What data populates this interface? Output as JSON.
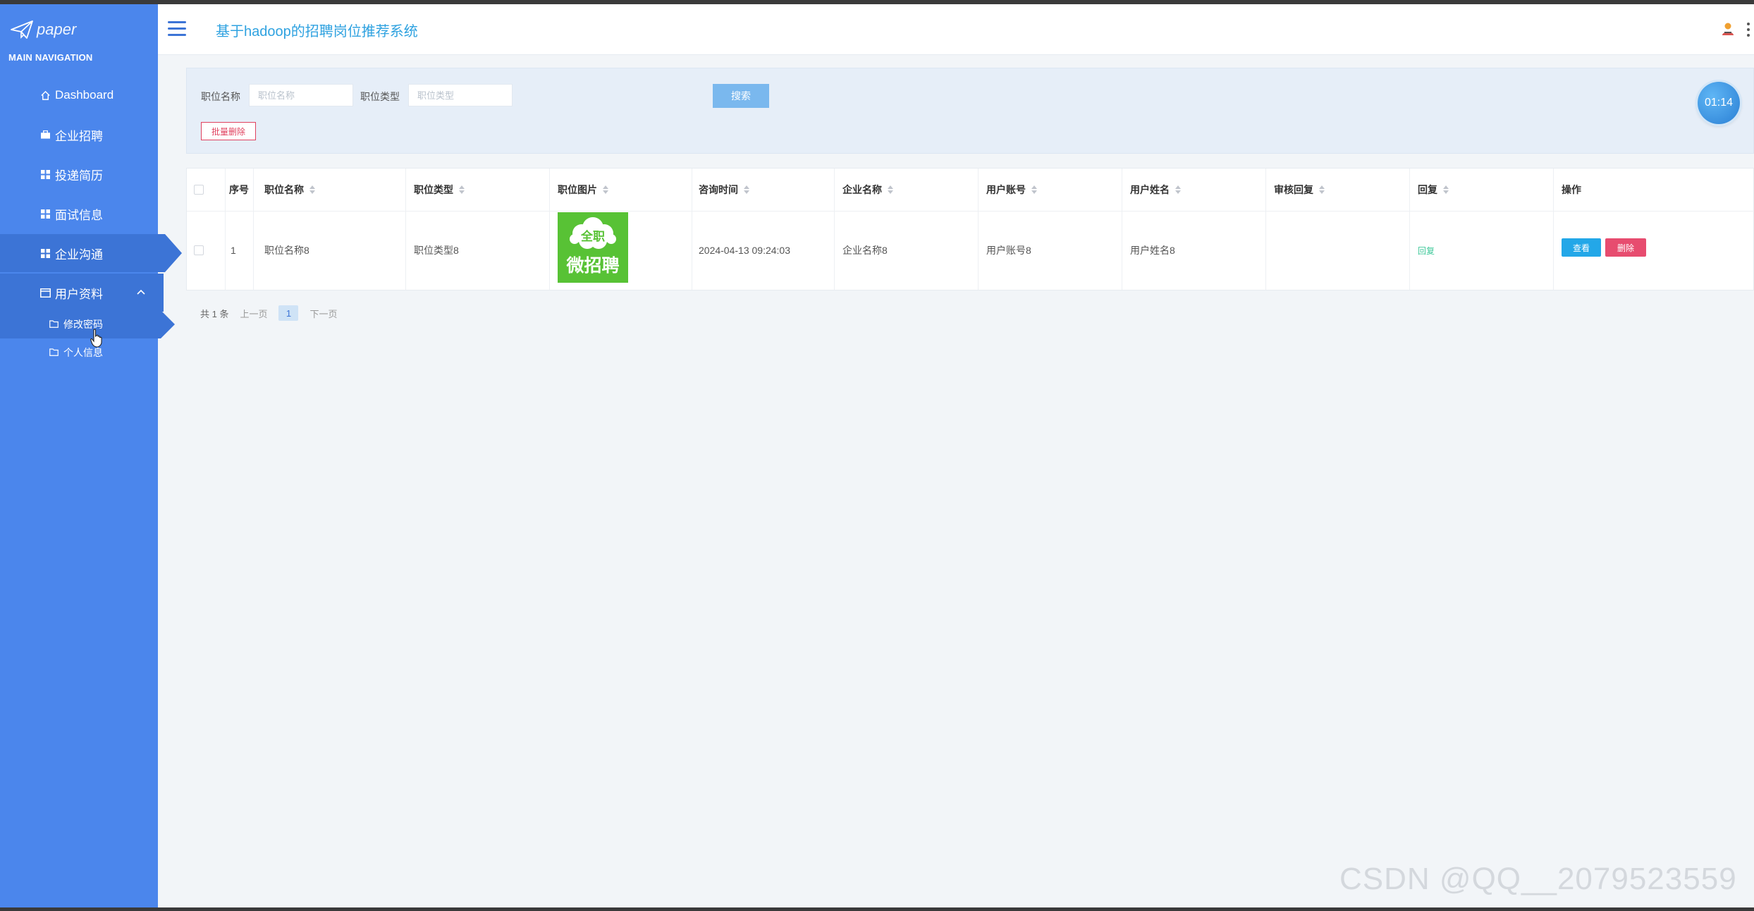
{
  "brand": {
    "logo_text": "paper"
  },
  "sidebar": {
    "heading": "MAIN NAVIGATION",
    "items": [
      {
        "label": "Dashboard",
        "icon": "home-icon"
      },
      {
        "label": "企业招聘",
        "icon": "briefcase-icon"
      },
      {
        "label": "投递简历",
        "icon": "grid-icon"
      },
      {
        "label": "面试信息",
        "icon": "grid-icon"
      },
      {
        "label": "企业沟通",
        "icon": "grid-icon",
        "active": true
      },
      {
        "label": "用户资料",
        "icon": "card-icon",
        "expanded": true
      }
    ],
    "subitems": [
      {
        "label": "修改密码",
        "active": true
      },
      {
        "label": "个人信息"
      }
    ]
  },
  "header": {
    "title": "基于hadoop的招聘岗位推荐系统"
  },
  "search": {
    "field1_label": "职位名称",
    "field1_placeholder": "职位名称",
    "field2_label": "职位类型",
    "field2_placeholder": "职位类型",
    "search_button": "搜索",
    "batch_delete_button": "批量删除"
  },
  "timer": "01:14",
  "table": {
    "headers": [
      "序号",
      "职位名称",
      "职位类型",
      "职位图片",
      "咨询时间",
      "企业名称",
      "用户账号",
      "用户姓名",
      "审核回复",
      "回复",
      "操作"
    ],
    "rows": [
      {
        "index": "1",
        "job_name": "职位名称8",
        "job_type": "职位类型8",
        "image_line1": "全职",
        "image_line2": "微招聘",
        "consult_time": "2024-04-13 09:24:03",
        "company": "企业名称8",
        "account": "用户账号8",
        "username": "用户姓名8",
        "review_reply": "",
        "reply": "回复",
        "view": "查看",
        "delete": "删除"
      }
    ]
  },
  "pagination": {
    "total": "共 1 条",
    "prev": "上一页",
    "current": "1",
    "next": "下一页"
  },
  "watermark": "CSDN @QQ__2079523559",
  "colors": {
    "sidebar_bg": "#4b86ec",
    "sidebar_active": "#3c74d6",
    "title": "#2fa2e0",
    "view_button": "#23a7e8",
    "delete_button": "#e74c6f",
    "reply_link": "#3fc89a",
    "image_green": "#58c235"
  }
}
